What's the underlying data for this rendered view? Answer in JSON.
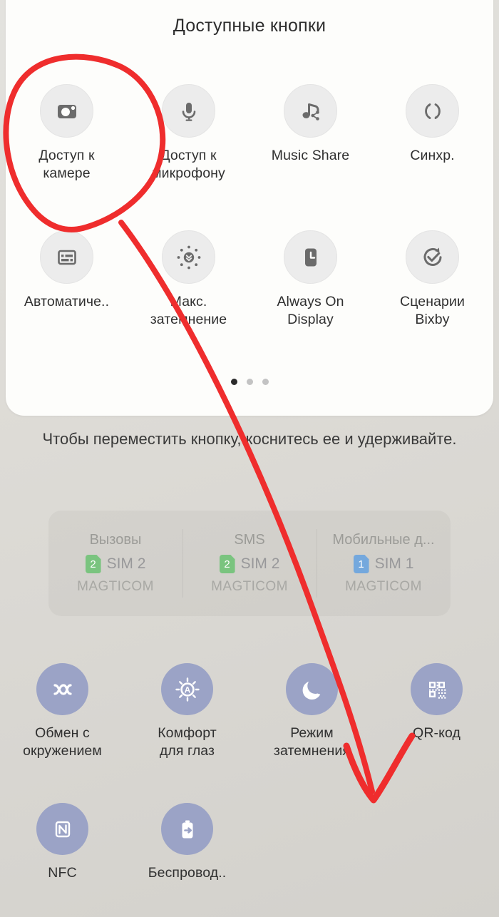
{
  "panel": {
    "title": "Доступные кнопки",
    "rows": [
      [
        {
          "label": "Доступ к\nкамере",
          "icon": "camera-icon"
        },
        {
          "label": "Доступ к\nмикрофону",
          "icon": "microphone-icon"
        },
        {
          "label": "Music Share",
          "icon": "music-share-icon"
        },
        {
          "label": "Синхр.",
          "icon": "sync-icon"
        }
      ],
      [
        {
          "label": "Автоматиче..",
          "icon": "subtitles-icon"
        },
        {
          "label": "Макс.\nзатемнение",
          "icon": "extra-dim-icon"
        },
        {
          "label": "Always On\nDisplay",
          "icon": "always-on-display-icon"
        },
        {
          "label": "Сценарии\nBixby",
          "icon": "bixby-routines-icon"
        }
      ]
    ],
    "pager": {
      "count": 3,
      "active": 0
    }
  },
  "hint": "Чтобы переместить кнопку, коснитесь ее и удерживайте.",
  "sim_panel": {
    "columns": [
      {
        "header": "Вызовы",
        "badge": "2",
        "badge_color": "#7ac47f",
        "sim": "SIM 2",
        "carrier": "MAGTICOM"
      },
      {
        "header": "SMS",
        "badge": "2",
        "badge_color": "#7ac47f",
        "sim": "SIM 2",
        "carrier": "MAGTICOM"
      },
      {
        "header": "Мобильные д...",
        "badge": "1",
        "badge_color": "#74a8dd",
        "sim": "SIM 1",
        "carrier": "MAGTICOM"
      }
    ]
  },
  "quick_settings": {
    "accent_color": "#9ba3c6",
    "rows": [
      [
        {
          "label": "Обмен с\nокружением",
          "icon": "quick-share-icon"
        },
        {
          "label": "Комфорт\nдля глаз",
          "icon": "eye-comfort-icon"
        },
        {
          "label": "Режим\nзатемнения",
          "icon": "dark-mode-moon-icon"
        },
        {
          "label": "QR-код",
          "icon": "qr-code-icon"
        }
      ],
      [
        {
          "label": "NFC",
          "icon": "nfc-icon"
        },
        {
          "label": "Беспровод..",
          "icon": "wireless-power-share-icon"
        }
      ]
    ]
  },
  "annotation": {
    "color": "#ef2d2d",
    "shapes": [
      "circle-around-camera-tile",
      "arrow-to-qr-code-tile"
    ]
  }
}
